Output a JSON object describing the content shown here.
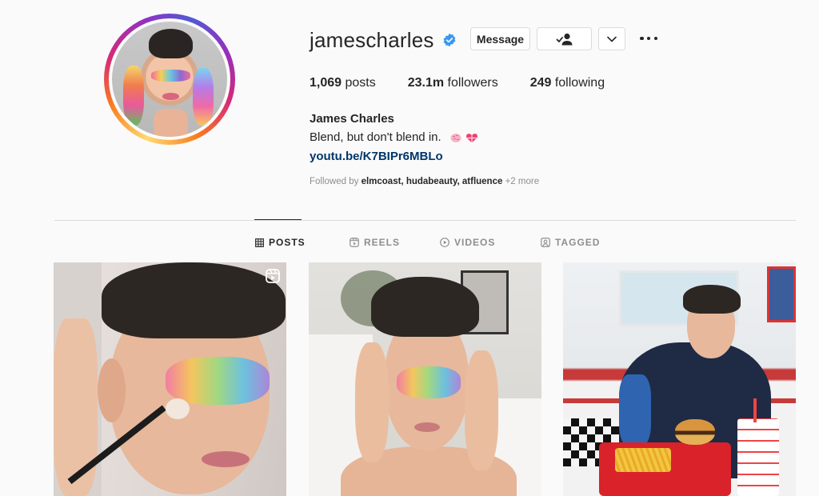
{
  "profile": {
    "username": "jamescharles",
    "verified": true,
    "buttons": {
      "message": "Message"
    },
    "stats": {
      "posts_count": "1,069",
      "posts_label": " posts",
      "followers_count": "23.1m",
      "followers_label": " followers",
      "following_count": "249",
      "following_label": " following"
    },
    "full_name": "James Charles",
    "bio": "Blend, but don't blend in.",
    "bio_emojis": [
      "brain-icon",
      "heart-gift-icon"
    ],
    "link": "youtu.be/K7BIPr6MBLo",
    "followed_by": {
      "prefix": "Followed by ",
      "users": [
        "elmcoast",
        "hudabeauty",
        "atfluence"
      ],
      "sep1": ", ",
      "sep2": ", ",
      "more": " +2 more"
    }
  },
  "tabs": [
    {
      "label": "POSTS",
      "icon": "grid-icon",
      "active": true
    },
    {
      "label": "REELS",
      "icon": "reels-icon",
      "active": false
    },
    {
      "label": "VIDEOS",
      "icon": "play-icon",
      "active": false
    },
    {
      "label": "TAGGED",
      "icon": "tag-icon",
      "active": false
    }
  ],
  "posts": [
    {
      "type": "reel",
      "description": "makeup brush rainbow eyeshadow"
    },
    {
      "type": "photo",
      "description": "hands framing face rainbow eyeshadow"
    },
    {
      "type": "photo",
      "description": "diner eating fries and burger"
    }
  ],
  "colors": {
    "text": "#262626",
    "secondary": "#8e8e8e",
    "link": "#00376b",
    "verified": "#3897f0",
    "border": "#dbdbdb",
    "background": "#fafafa"
  }
}
